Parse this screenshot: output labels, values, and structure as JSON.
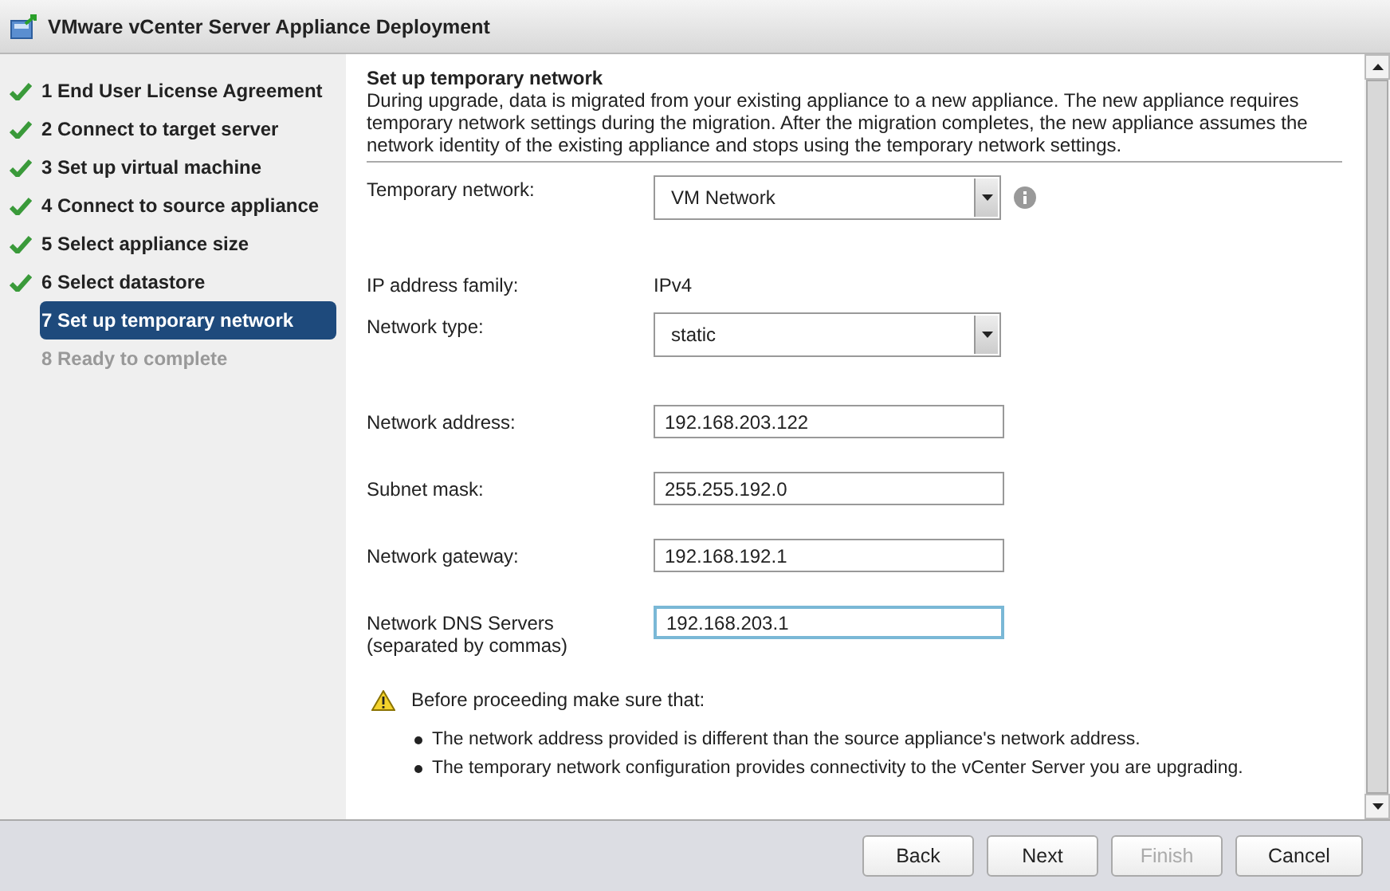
{
  "window": {
    "title": "VMware vCenter Server Appliance Deployment"
  },
  "steps": [
    {
      "label": "1 End User License Agreement",
      "checked": true,
      "selected": false,
      "disabled": false
    },
    {
      "label": "2 Connect to target server",
      "checked": true,
      "selected": false,
      "disabled": false
    },
    {
      "label": "3 Set up virtual machine",
      "checked": true,
      "selected": false,
      "disabled": false
    },
    {
      "label": "4 Connect to source appliance",
      "checked": true,
      "selected": false,
      "disabled": false
    },
    {
      "label": "5 Select appliance size",
      "checked": true,
      "selected": false,
      "disabled": false
    },
    {
      "label": "6 Select datastore",
      "checked": true,
      "selected": false,
      "disabled": false
    },
    {
      "label": "7 Set up temporary network",
      "checked": false,
      "selected": true,
      "disabled": false
    },
    {
      "label": "8 Ready to complete",
      "checked": false,
      "selected": false,
      "disabled": true
    }
  ],
  "section": {
    "title": "Set up temporary network",
    "description": "During upgrade, data is migrated from your existing appliance to a new appliance. The new appliance requires temporary network settings during the migration. After the migration completes, the new appliance assumes the network identity of the existing appliance and stops using the temporary network settings."
  },
  "fields": [
    {
      "kind": "select",
      "label": "Temporary network:",
      "value": "VM Network",
      "help": true
    },
    {
      "kind": "text",
      "label": "IP address family:",
      "value": "IPv4"
    },
    {
      "kind": "select",
      "label": "Network type:",
      "value": "static",
      "help": false
    },
    {
      "kind": "input",
      "label": "Network address:",
      "value": "192.168.203.122",
      "focused": false
    },
    {
      "kind": "input",
      "label": "Subnet mask:",
      "value": "255.255.192.0",
      "focused": false
    },
    {
      "kind": "input",
      "label": "Network gateway:",
      "value": "192.168.192.1",
      "focused": false
    },
    {
      "kind": "input",
      "label": "Network DNS Servers",
      "sublabel": "(separated by commas)",
      "value": "192.168.203.1",
      "focused": true
    }
  ],
  "warning": {
    "title": "Before proceeding make sure that:",
    "items": [
      "The network address provided is different than the source appliance's network address.",
      "The temporary network configuration provides connectivity to the vCenter Server you are upgrading."
    ]
  },
  "buttons": [
    {
      "label": "Back",
      "disabled": false
    },
    {
      "label": "Next",
      "disabled": false
    },
    {
      "label": "Finish",
      "disabled": true
    },
    {
      "label": "Cancel",
      "disabled": false
    }
  ]
}
